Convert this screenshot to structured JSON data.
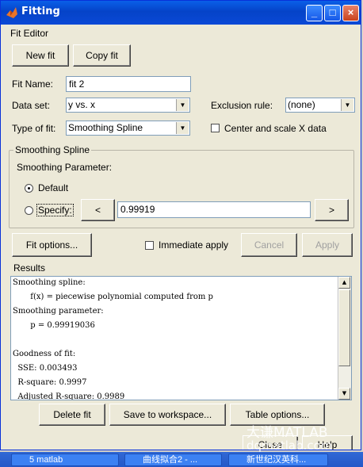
{
  "window": {
    "title": "Fitting"
  },
  "fit_editor": {
    "label": "Fit Editor",
    "new_fit": "New fit",
    "copy_fit": "Copy fit",
    "fit_name_label": "Fit Name:",
    "fit_name_value": "fit 2",
    "data_set_label": "Data set:",
    "data_set_value": "y vs. x",
    "exclusion_label": "Exclusion rule:",
    "exclusion_value": "(none)",
    "type_label": "Type of fit:",
    "type_value": "Smoothing Spline",
    "center_scale_label": "Center and scale X data"
  },
  "smoothing": {
    "group_title": "Smoothing Spline",
    "param_label": "Smoothing Parameter:",
    "default_label": "Default",
    "specify_label": "Specify:",
    "decrease": "<",
    "value": "0.99919",
    "increase": ">"
  },
  "actions": {
    "fit_options": "Fit options...",
    "immediate_apply": "Immediate apply",
    "cancel": "Cancel",
    "apply": "Apply"
  },
  "results": {
    "label": "Results",
    "lines": [
      "Smoothing spline:",
      "       f(x) = piecewise polynomial computed from p",
      "Smoothing parameter:",
      "       p = 0.99919036",
      "",
      "Goodness of fit:",
      "  SSE: 0.003493",
      "  R-square: 0.9997",
      "  Adjusted R-square: 0.9989"
    ]
  },
  "bottom": {
    "delete_fit": "Delete fit",
    "save_workspace": "Save to workspace...",
    "table_options": "Table options...",
    "close": "Close",
    "help": "Help"
  },
  "taskbar": {
    "items": [
      "5 matlab",
      "曲线拟合2 - ...",
      "新世纪汉英科..."
    ]
  },
  "watermark": {
    "line1": "大谦MATLAB",
    "line2": "dqmatlab.com"
  }
}
